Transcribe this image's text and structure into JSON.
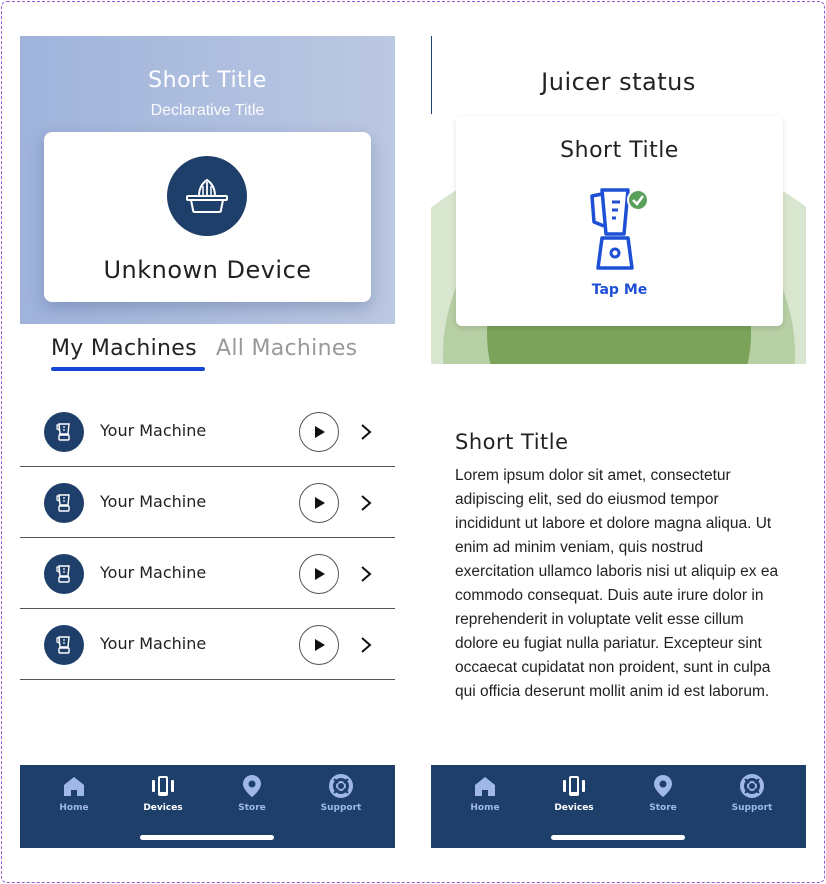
{
  "left_screen": {
    "hero": {
      "title": "Short Title",
      "subtitle": "Declarative Title",
      "device_name": "Unknown Device",
      "device_icon": "juicer-icon"
    },
    "tabs": [
      {
        "label": "My Machines",
        "active": true
      },
      {
        "label": "All Machines",
        "active": false
      }
    ],
    "machines": [
      {
        "name": "Your Machine",
        "icon": "blender-icon"
      },
      {
        "name": "Your Machine",
        "icon": "blender-icon"
      },
      {
        "name": "Your Machine",
        "icon": "blender-icon"
      },
      {
        "name": "Your Machine",
        "icon": "blender-icon"
      }
    ]
  },
  "right_screen": {
    "title": "Juicer status",
    "card": {
      "title": "Short Title",
      "action": "Tap Me",
      "icon": "blender-check-icon"
    },
    "article": {
      "title": "Short Title",
      "body": "Lorem ipsum dolor sit amet, consectetur adipiscing elit, sed do eiusmod tempor incididunt ut labore et dolore magna aliqua. Ut enim ad minim veniam, quis nostrud exercitation ullamco laboris nisi ut aliquip ex ea commodo consequat. Duis aute irure dolor in reprehenderit in voluptate velit esse cillum dolore eu fugiat nulla pariatur. Excepteur sint occaecat cupidatat non proident, sunt in culpa qui officia deserunt mollit anim id est laborum."
    }
  },
  "bottom_nav": {
    "items": [
      {
        "label": "Home",
        "icon": "home-icon",
        "active": false
      },
      {
        "label": "Devices",
        "icon": "devices-icon",
        "active": true
      },
      {
        "label": "Store",
        "icon": "location-pin-icon",
        "active": false
      },
      {
        "label": "Support",
        "icon": "lifebuoy-icon",
        "active": false
      }
    ]
  },
  "colors": {
    "navy": "#1e3f6a",
    "accent_blue": "#1447d4",
    "green_ring": "#7ba35a",
    "check_green": "#5aa05a",
    "hero_gradient_start": "#9fb3db",
    "hero_gradient_end": "#bcc8e2"
  }
}
